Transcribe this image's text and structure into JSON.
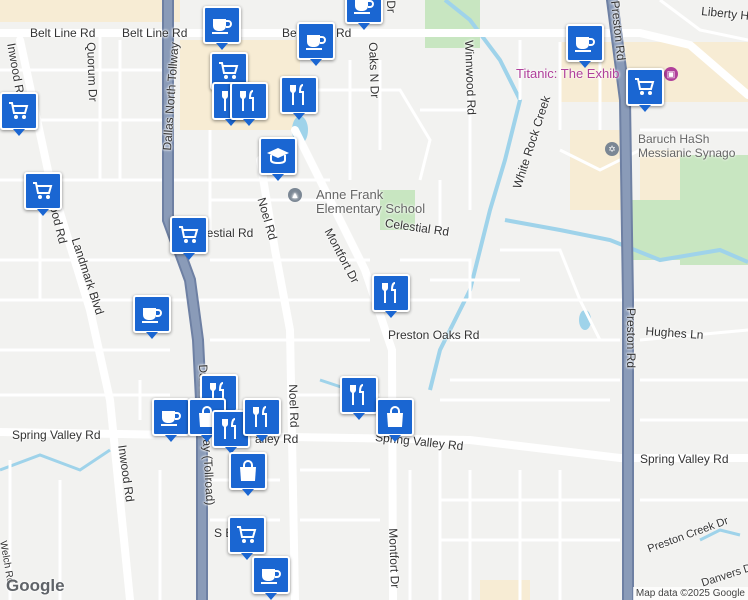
{
  "map": {
    "roads": {
      "belt_line_rd": "Belt Line Rd",
      "belt_line_rd_2": "Belt Line Rd",
      "be_fragment": "Be",
      "inwood_rd_top": "Inwood Rd",
      "inwood_rd_mid": "Inwood Rd",
      "inwood_rd_bottom": "Inwood Rd",
      "quorum_dr": "Quorum Dr",
      "landmark_blvd": "Landmark Blvd",
      "dallas_north_tollway": "Dallas North Tollway",
      "tollway_bottom": "Dallas N Tollway (Tollroad)",
      "noel_rd_top": "Noel Rd",
      "noel_rd_bottom": "Noel Rd",
      "celestial_rd_left": "lestial Rd",
      "celestial_rd_right": "Celestial Rd",
      "montfort_dr_top": "Montfort Dr",
      "montfort_dr_bottom": "Montfort Dr",
      "oaks_n_dr": "Oaks N Dr",
      "preston_oaks_rd": "Preston Oaks Rd",
      "spring_valley_rd_left": "Spring Valley Rd",
      "spring_valley_rd_mid": "alley Rd",
      "spring_valley_rd_center": "Spring Valley Rd",
      "spring_valley_rd_right": "Spring Valley Rd",
      "winnwood_rd": "Winnwood Rd",
      "white_rock_creek": "White Rock Creek",
      "preston_rd_top": "Preston Rd",
      "preston_rd_mid": "Preston Rd",
      "hughes_ln": "Hughes Ln",
      "liberty_fragment": "Liberty H",
      "preston_creek_dr": "Preston Creek Dr",
      "danvers_dr": "Danvers Dr",
      "welch_rd": "Welch Rd",
      "scotts_blvd": "S                Blvd",
      "stmont_fragment": "Dr"
    },
    "places": {
      "anne_frank_school_line1": "Anne Frank",
      "anne_frank_school_line2": "Elementary School",
      "titanic": "Titanic: The Exhib",
      "baruch_line1": "Baruch HaSh",
      "baruch_line2": "Messianic Synago"
    },
    "markers": [
      {
        "type": "cafe",
        "name": "cafe-marker"
      },
      {
        "type": "cafe",
        "name": "cafe-marker"
      },
      {
        "type": "cafe",
        "name": "cafe-marker"
      },
      {
        "type": "cafe",
        "name": "cafe-marker"
      },
      {
        "type": "cafe",
        "name": "cafe-marker"
      },
      {
        "type": "cafe",
        "name": "cafe-marker"
      },
      {
        "type": "restaurant",
        "name": "restaurant-marker"
      },
      {
        "type": "shopping",
        "name": "shopping-marker"
      }
    ],
    "branding": "Google",
    "attribution": "Map data ©2025 Google",
    "colors": {
      "background": "#f2f2f0",
      "highway": "#8a9bb8",
      "arterial": "#ffffff",
      "park": "#c8e6c1",
      "commercial": "#f7ecd4",
      "water": "#9fd3ea",
      "marker": "#1a66d2"
    }
  }
}
